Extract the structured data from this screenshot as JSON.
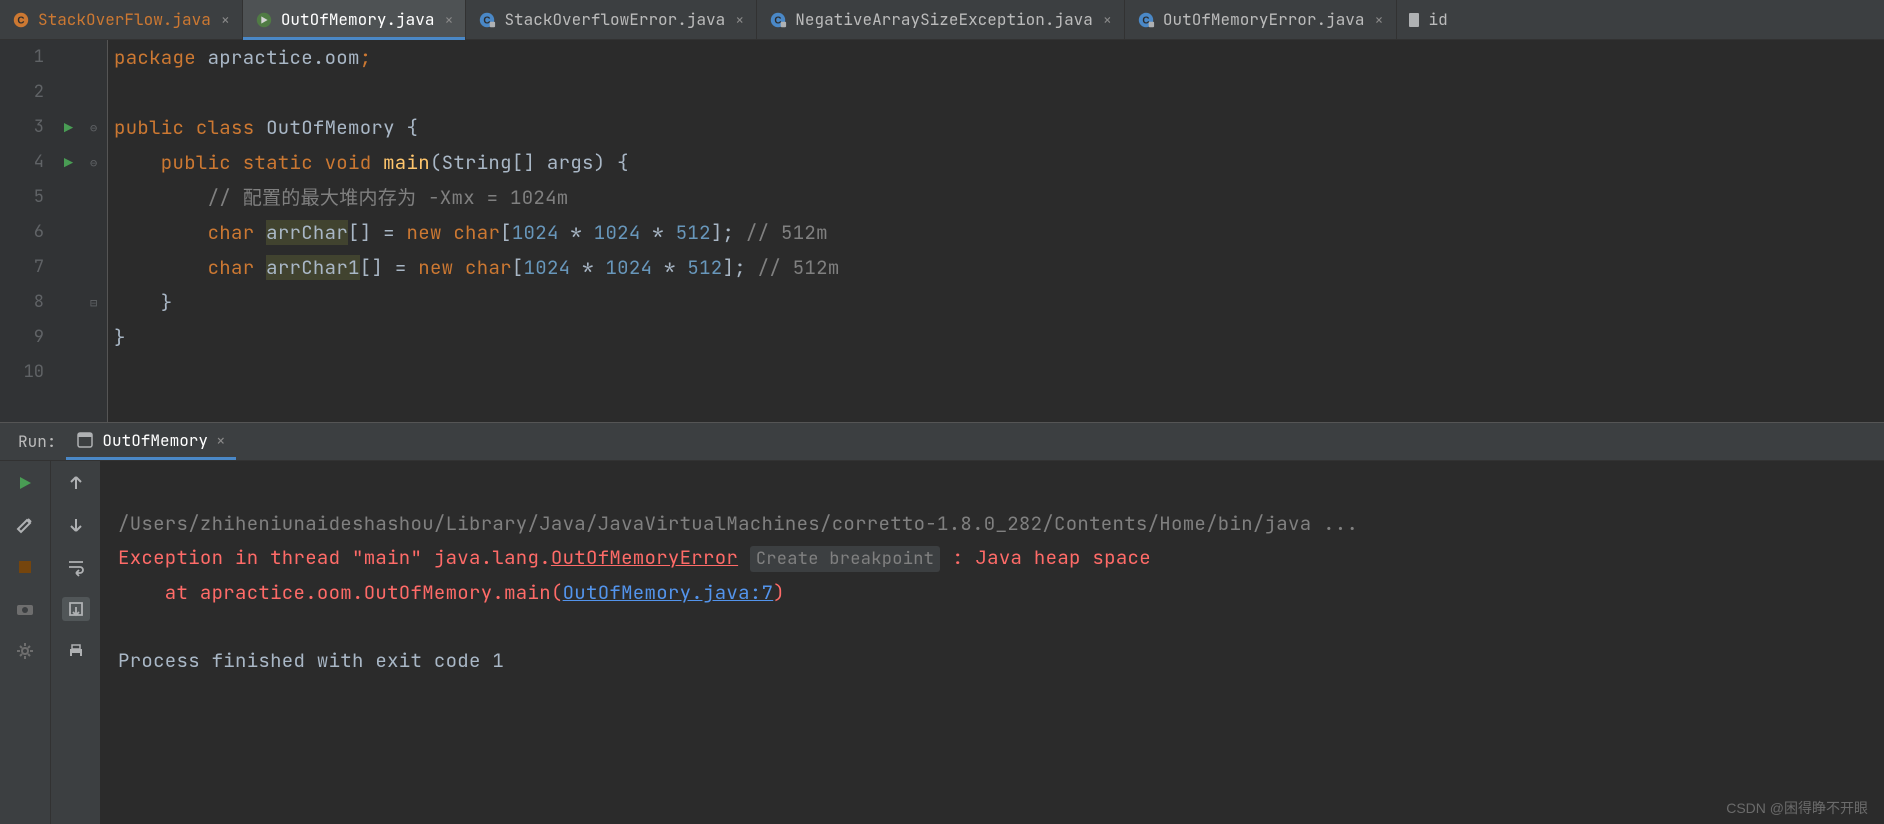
{
  "tabs": [
    {
      "label": "StackOverFlow.java",
      "type": "java-mod"
    },
    {
      "label": "OutOfMemory.java",
      "type": "java-run",
      "active": true
    },
    {
      "label": "StackOverflowError.java",
      "type": "java-lock"
    },
    {
      "label": "NegativeArraySizeException.java",
      "type": "java-lock"
    },
    {
      "label": "OutOfMemoryError.java",
      "type": "java-lock"
    }
  ],
  "partial_tab": "id",
  "code": {
    "lines": [
      "1",
      "2",
      "3",
      "4",
      "5",
      "6",
      "7",
      "8",
      "9",
      "10"
    ],
    "run_marks": [
      3,
      4
    ],
    "fold_open": [
      3,
      4
    ],
    "fold_close": [
      8
    ],
    "tokens": [
      [
        {
          "t": "package ",
          "c": "kw"
        },
        {
          "t": "apractice.oom",
          "c": "cls"
        },
        {
          "t": ";",
          "c": "kw"
        }
      ],
      [],
      [
        {
          "t": "public class ",
          "c": "kw"
        },
        {
          "t": "OutOfMemory ",
          "c": "cls"
        },
        {
          "t": "{",
          "c": "cls"
        }
      ],
      [
        {
          "t": "    public static void ",
          "c": "kw"
        },
        {
          "t": "main",
          "c": "fn"
        },
        {
          "t": "(String[] args) {",
          "c": "cls"
        }
      ],
      [
        {
          "t": "        ",
          "c": ""
        },
        {
          "t": "// 配置的最大堆内存为 -Xmx = 1024m",
          "c": "cmt"
        }
      ],
      [
        {
          "t": "        ",
          "c": ""
        },
        {
          "t": "char ",
          "c": "kw"
        },
        {
          "t": "arrChar",
          "c": "hl"
        },
        {
          "t": "[] = ",
          "c": "cls"
        },
        {
          "t": "new char",
          "c": "kw"
        },
        {
          "t": "[",
          "c": "cls"
        },
        {
          "t": "1024 ",
          "c": "num"
        },
        {
          "t": "* ",
          "c": "cls"
        },
        {
          "t": "1024 ",
          "c": "num"
        },
        {
          "t": "* ",
          "c": "cls"
        },
        {
          "t": "512",
          "c": "num"
        },
        {
          "t": "]; ",
          "c": "cls"
        },
        {
          "t": "// 512m",
          "c": "cmt"
        }
      ],
      [
        {
          "t": "        ",
          "c": ""
        },
        {
          "t": "char ",
          "c": "kw"
        },
        {
          "t": "arrChar1",
          "c": "hl"
        },
        {
          "t": "[] = ",
          "c": "cls"
        },
        {
          "t": "new char",
          "c": "kw"
        },
        {
          "t": "[",
          "c": "cls"
        },
        {
          "t": "1024 ",
          "c": "num"
        },
        {
          "t": "* ",
          "c": "cls"
        },
        {
          "t": "1024 ",
          "c": "num"
        },
        {
          "t": "* ",
          "c": "cls"
        },
        {
          "t": "512",
          "c": "num"
        },
        {
          "t": "]; ",
          "c": "cls"
        },
        {
          "t": "// 512m",
          "c": "cmt"
        }
      ],
      [
        {
          "t": "    }",
          "c": "cls"
        }
      ],
      [
        {
          "t": "}",
          "c": "cls"
        }
      ],
      []
    ]
  },
  "run": {
    "label": "Run:",
    "config": "OutOfMemory",
    "console": {
      "cmd": "/Users/zhiheniunaideshashou/Library/Java/JavaVirtualMachines/corretto-1.8.0_282/Contents/Home/bin/java ...",
      "ex_prefix": "Exception in thread \"main\" java.lang.",
      "ex_class": "OutOfMemoryError",
      "hint": "Create breakpoint",
      "ex_suffix": " : Java heap space",
      "at_prefix": "    at apractice.oom.OutOfMemory.main(",
      "at_link": "OutOfMemory.java:7",
      "at_suffix": ")",
      "exit": "Process finished with exit code 1"
    }
  },
  "watermark": "CSDN @困得睁不开眼"
}
